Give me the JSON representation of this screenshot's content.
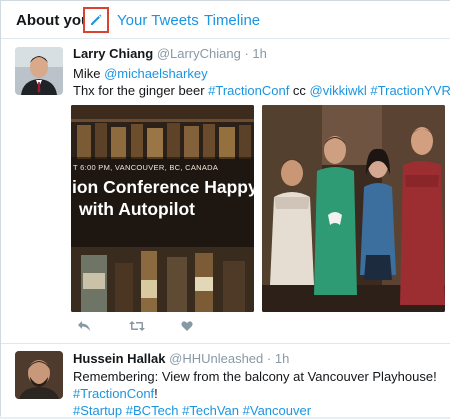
{
  "tabs": {
    "active": "About you",
    "edit_icon": "pencil-icon",
    "links": [
      "Your Tweets",
      "Timeline"
    ]
  },
  "tweets": [
    {
      "name": "Larry Chiang",
      "handle": "@LarryChiang",
      "dot": "·",
      "time": "1h",
      "lines": [
        [
          {
            "t": "Mike ",
            "link": false
          },
          {
            "t": "@michaelsharkey",
            "link": true
          }
        ],
        [
          {
            "t": "Thx for the ginger beer ",
            "link": false
          },
          {
            "t": "#TractionConf",
            "link": true
          },
          {
            "t": " cc ",
            "link": false
          },
          {
            "t": "@vikkiwkl",
            "link": true
          },
          {
            "t": " ",
            "link": false
          },
          {
            "t": "#TractionYVR",
            "link": true
          }
        ]
      ],
      "photo_left": {
        "small": "T 6:00 PM, VANCOUVER, BC, CANADA",
        "line1": "ion Conference Happy",
        "line2": "with Autopilot"
      },
      "actions": [
        "reply-icon",
        "retweet-icon",
        "like-icon"
      ]
    },
    {
      "name": "Hussein Hallak",
      "handle": "@HHUnleashed",
      "dot": "·",
      "time": "1h",
      "lines": [
        [
          {
            "t": "Remembering: View from the balcony at Vancouver Playhouse!",
            "link": false
          }
        ],
        [
          {
            "t": "#TractionConf",
            "link": true
          },
          {
            "t": "!",
            "link": false
          }
        ],
        [
          {
            "t": "#Startup",
            "link": true
          },
          {
            "t": " ",
            "link": false
          },
          {
            "t": "#BCTech",
            "link": true
          },
          {
            "t": " ",
            "link": false
          },
          {
            "t": "#TechVan",
            "link": true
          },
          {
            "t": " ",
            "link": false
          },
          {
            "t": "#Vancouver",
            "link": true
          }
        ]
      ]
    }
  ],
  "colors": {
    "link": "#1b95e0",
    "highlight_border": "#d9432f",
    "muted": "#8899a6"
  }
}
